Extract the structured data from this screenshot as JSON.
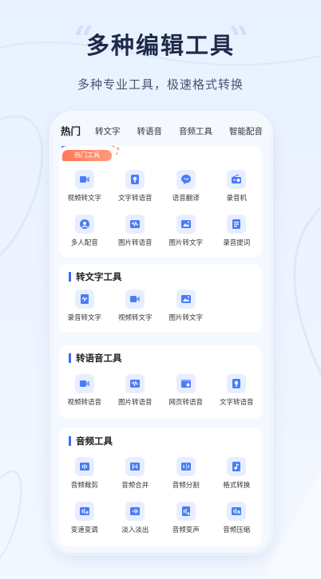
{
  "header": {
    "title": "多种编辑工具",
    "subtitle": "多种专业工具，极速格式转换"
  },
  "tabs": [
    {
      "label": "热门",
      "active": true
    },
    {
      "label": "转文字"
    },
    {
      "label": "转语音"
    },
    {
      "label": "音频工具"
    },
    {
      "label": "智能配音"
    }
  ],
  "hot": {
    "badge": "热门工具",
    "items": [
      {
        "label": "视频转文字",
        "icon": "video-icon"
      },
      {
        "label": "文字转语音",
        "icon": "text-voice-icon"
      },
      {
        "label": "语音翻译",
        "icon": "chat-icon"
      },
      {
        "label": "录音机",
        "icon": "radio-icon"
      },
      {
        "label": "多人配音",
        "icon": "people-icon"
      },
      {
        "label": "图片转语音",
        "icon": "image-wave-icon"
      },
      {
        "label": "图片转文字",
        "icon": "image-icon"
      },
      {
        "label": "录音提词",
        "icon": "doc-icon"
      }
    ]
  },
  "text_tools": {
    "title": "转文字工具",
    "items": [
      {
        "label": "录音转文字",
        "icon": "record-text-icon"
      },
      {
        "label": "视频转文字",
        "icon": "video-icon"
      },
      {
        "label": "图片转文字",
        "icon": "image-icon"
      }
    ]
  },
  "voice_tools": {
    "title": "转语音工具",
    "items": [
      {
        "label": "视频转语音",
        "icon": "video-icon"
      },
      {
        "label": "图片转语音",
        "icon": "image-wave-icon"
      },
      {
        "label": "网页转语音",
        "icon": "web-icon"
      },
      {
        "label": "文字转语音",
        "icon": "text-voice-icon"
      }
    ]
  },
  "audio_tools": {
    "title": "音频工具",
    "items": [
      {
        "label": "音频裁剪",
        "icon": "cut-icon"
      },
      {
        "label": "音频合并",
        "icon": "merge-icon"
      },
      {
        "label": "音频分割",
        "icon": "split-icon"
      },
      {
        "label": "格式转换",
        "icon": "convert-icon"
      },
      {
        "label": "变速变调",
        "icon": "speed-icon"
      },
      {
        "label": "淡入淡出",
        "icon": "fade-icon"
      },
      {
        "label": "音频变声",
        "icon": "voice-change-icon"
      },
      {
        "label": "音频压缩",
        "icon": "compress-icon"
      }
    ]
  },
  "colors": {
    "accent": "#3b6df5",
    "icon_bg": "#e6eeff",
    "hot_badge": "#ff7a5a"
  }
}
